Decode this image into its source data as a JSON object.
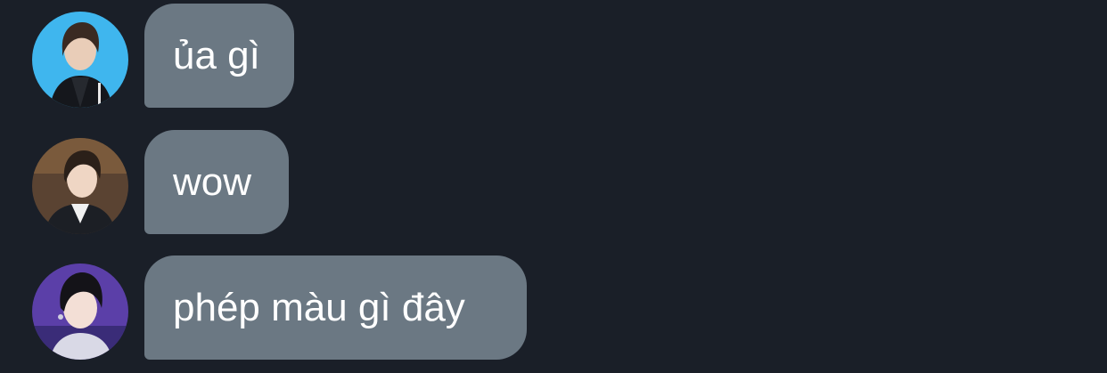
{
  "messages": [
    {
      "text": "ủa gì",
      "avatar": "avatar-icon"
    },
    {
      "text": "wow",
      "avatar": "avatar-icon"
    },
    {
      "text": "phép màu gì đây",
      "avatar": "avatar-icon"
    }
  ],
  "colors": {
    "background": "#1a1f28",
    "bubble": "#6b7883",
    "text": "#ffffff"
  }
}
